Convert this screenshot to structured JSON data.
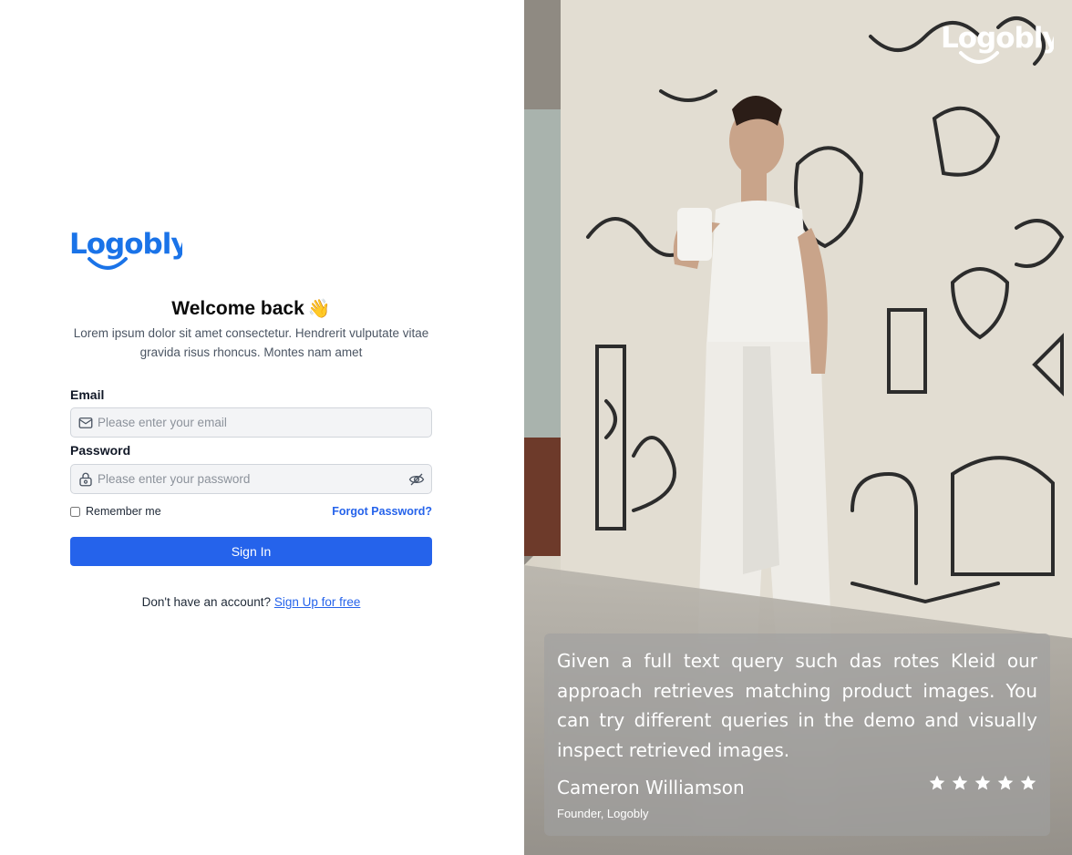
{
  "brand": {
    "name": "Logobly",
    "color": "#1a73e8"
  },
  "login": {
    "title": "Welcome back",
    "title_emoji": "👋",
    "subtitle": "Lorem ipsum dolor sit amet consectetur. Hendrerit vulputate vitae gravida risus rhoncus. Montes nam amet",
    "email_label": "Email",
    "email_placeholder": "Please enter your email",
    "email_value": "",
    "password_label": "Password",
    "password_placeholder": "Please enter your password",
    "password_value": "",
    "remember_label": "Remember me",
    "remember_checked": false,
    "forgot_label": "Forgot Password?",
    "signin_label": "Sign In",
    "signup_prompt": "Don't have an account?",
    "signup_link": "Sign Up for free"
  },
  "testimonial": {
    "quote": "Given a full text query such das rotes Kleid our approach retrieves matching product images. You can try different queries in the demo and visually inspect retrieved images.",
    "author": "Cameron Williamson",
    "role": "Founder, Logobly",
    "rating": 5
  },
  "icons": {
    "email": "mail-icon",
    "password": "lock-icon",
    "toggle": "eye-off-icon",
    "star": "star-icon"
  },
  "colors": {
    "primary": "#2563eb",
    "field_bg": "#f3f4f6",
    "muted_text": "#4b5563"
  }
}
